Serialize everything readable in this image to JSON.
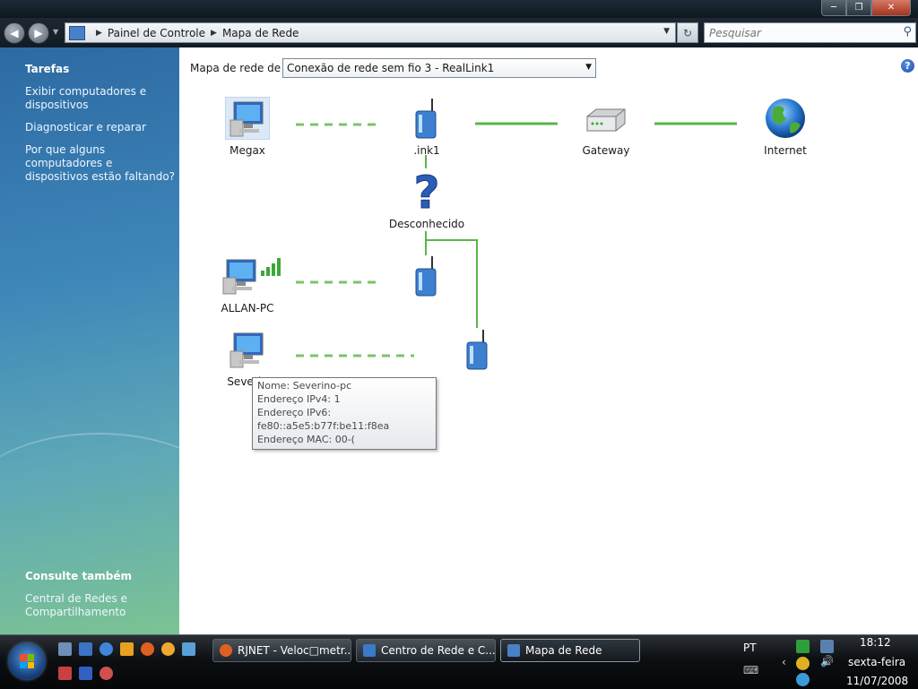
{
  "window": {
    "minimize_icon": "minimize-icon",
    "maximize_icon": "maximize-icon",
    "close_icon": "close-icon"
  },
  "address": {
    "crumbs": [
      "Painel de Controle",
      "Mapa de Rede"
    ],
    "search_placeholder": "Pesquisar"
  },
  "sidebar": {
    "tasks_heading": "Tarefas",
    "tasks": [
      "Exibir computadores e dispositivos",
      "Diagnosticar e reparar",
      "Por que alguns computadores e dispositivos estão faltando?"
    ],
    "see_also_heading": "Consulte também",
    "see_also": [
      "Central de Redes e Compartilhamento"
    ]
  },
  "main": {
    "map_label": "Mapa de rede de",
    "selected_connection": "Conexão de rede sem fio 3 - RealLink1",
    "help_icon": "help-icon"
  },
  "nodes": {
    "megax": "Megax",
    "router_top": ".ink1",
    "gateway": "Gateway",
    "internet": "Internet",
    "unknown": "Desconhecido",
    "allan": "ALLAN-PC",
    "severino": "Severin"
  },
  "tooltip": {
    "line1": "Nome: Severino-pc",
    "line2": "Endereço IPv4: 1",
    "line3": "Endereço IPv6:",
    "line4": "fe80::a5e5:b77f:be11:f8ea",
    "line5": "Endereço MAC: 00-("
  },
  "taskbar": {
    "tasks": [
      "RJNET - Veloc□metr...",
      "Centro de Rede e C...",
      "Mapa de Rede"
    ],
    "language": "PT",
    "time": "18:12",
    "day": "sexta-feira",
    "date": "11/07/2008"
  },
  "colors": {
    "link_solid": "#44aa33",
    "link_wireless": "#88cc77"
  }
}
